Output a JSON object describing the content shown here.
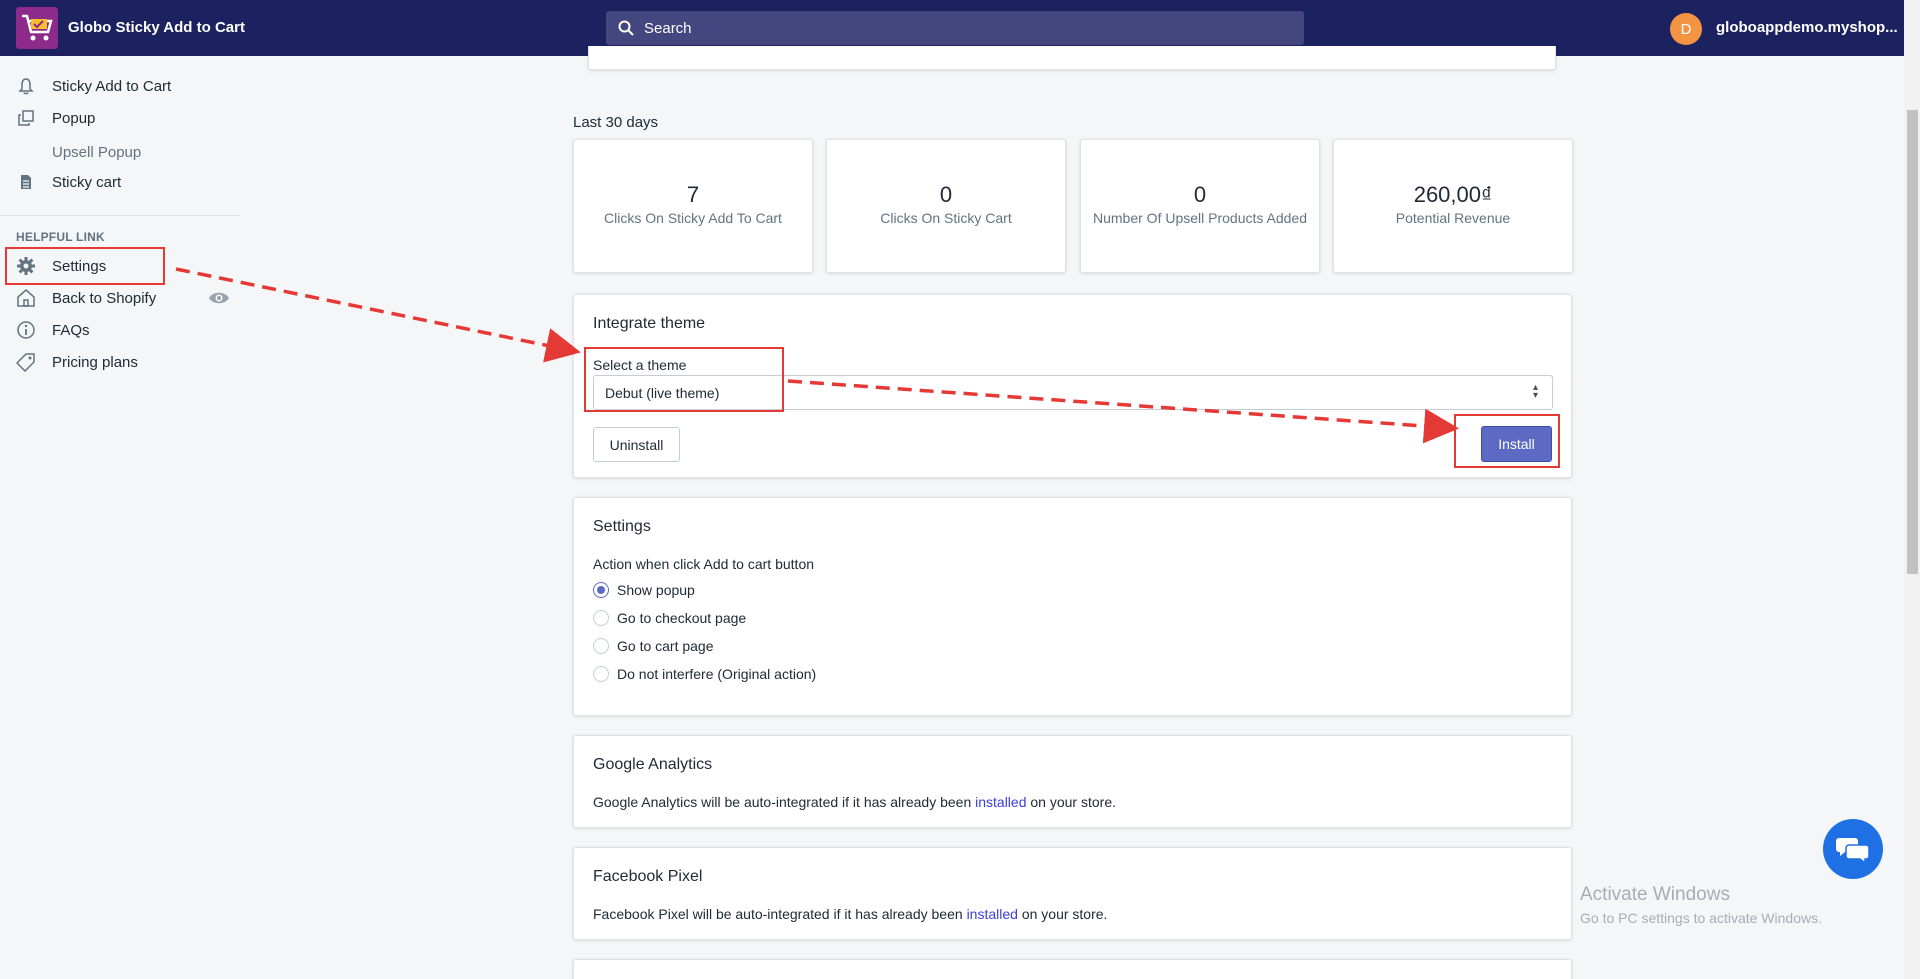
{
  "app": {
    "title": "Globo Sticky Add to Cart",
    "store": "globoappdemo.myshop...",
    "avatar_initial": "D"
  },
  "search": {
    "placeholder": "Search"
  },
  "sidebar": {
    "items": [
      {
        "label": "Sticky Add to Cart",
        "icon": "bell-icon"
      },
      {
        "label": "Popup",
        "icon": "copy-icon"
      },
      {
        "label": "Upsell Popup",
        "icon": ""
      },
      {
        "label": "Sticky cart",
        "icon": "document-icon"
      }
    ],
    "helpful_heading": "HELPFUL LINK",
    "helpful": [
      {
        "label": "Settings",
        "icon": "gear-icon"
      },
      {
        "label": "Back to Shopify",
        "icon": "home-icon"
      },
      {
        "label": "FAQs",
        "icon": "info-icon"
      },
      {
        "label": "Pricing plans",
        "icon": "tag-icon"
      }
    ]
  },
  "stats": {
    "heading": "Last 30 days",
    "items": [
      {
        "value": "7",
        "label": "Clicks On Sticky Add To Cart"
      },
      {
        "value": "0",
        "label": "Clicks On Sticky Cart"
      },
      {
        "value": "0",
        "label": "Number Of Upsell Products Added"
      },
      {
        "value": "260,00₫",
        "label": "Potential Revenue"
      }
    ]
  },
  "integrate": {
    "title": "Integrate theme",
    "select_label": "Select a theme",
    "selected_theme": "Debut (live theme)",
    "uninstall_label": "Uninstall",
    "install_label": "Install"
  },
  "settings": {
    "title": "Settings",
    "question": "Action when click Add to cart button",
    "options": [
      {
        "label": "Show popup",
        "checked": true
      },
      {
        "label": "Go to checkout page",
        "checked": false
      },
      {
        "label": "Go to cart page",
        "checked": false
      },
      {
        "label": "Do not interfere (Original action)",
        "checked": false
      }
    ]
  },
  "ga": {
    "title": "Google Analytics",
    "text_before": "Google Analytics will be auto-integrated if it has already been",
    "link": "installed",
    "text_after": "on your store."
  },
  "fb": {
    "title": "Facebook Pixel",
    "text_before": "Facebook Pixel will be auto-integrated if it has already been",
    "link": "installed",
    "text_after": "on your store."
  },
  "watermark": {
    "line1": "Activate Windows",
    "line2": "Go to PC settings to activate Windows."
  },
  "colors": {
    "topbar": "#1c2260",
    "accent": "#5c6ac4",
    "annotation": "#e53935",
    "chat": "#1f6fe5"
  }
}
